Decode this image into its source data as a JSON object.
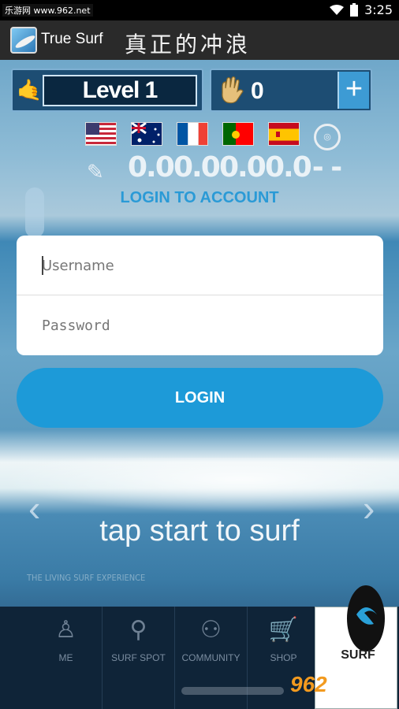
{
  "status_bar": {
    "watermark_text": "乐游网 www.962.net",
    "time": "3:25",
    "icons": [
      "wifi-icon",
      "battery-icon"
    ]
  },
  "app_bar": {
    "title": "True Surf",
    "subtitle": "真正的冲浪",
    "icon": "app-icon"
  },
  "hud": {
    "level_label": "Level 1",
    "coins": "0",
    "plus_label": "+",
    "icons": [
      "shaka-icon",
      "hand-icon",
      "plus-icon"
    ]
  },
  "flags": [
    {
      "country": "USA",
      "icon": "usa-flag-icon",
      "score": "0.0"
    },
    {
      "country": "Australia",
      "icon": "australia-flag-icon",
      "score": "0.0"
    },
    {
      "country": "France",
      "icon": "france-flag-icon",
      "score": "0.0"
    },
    {
      "country": "Portugal",
      "icon": "portugal-flag-icon",
      "score": "0.0"
    },
    {
      "country": "Spain",
      "icon": "spain-flag-icon",
      "score": "0.0"
    },
    {
      "country": "World",
      "icon": "world-seal-icon",
      "score": "- -"
    }
  ],
  "login": {
    "heading": "LOGIN TO ACCOUNT",
    "username_placeholder": "Username",
    "password_placeholder": "Password",
    "button_label": "LOGIN"
  },
  "main": {
    "tap_text": "tap start to surf",
    "fine_print": "THE LIVING SURF EXPERIENCE"
  },
  "bottom_nav": {
    "items": [
      {
        "label": "ME",
        "icon": "person-icon"
      },
      {
        "label": "SURF SPOT",
        "icon": "map-pin-icon"
      },
      {
        "label": "COMMUNITY",
        "icon": "community-icon"
      },
      {
        "label": "SHOP",
        "icon": "cart-icon"
      }
    ],
    "surf_label": "SURF"
  },
  "watermark": {
    "number": "962",
    "domain": ".NET",
    "cn": "乐游网"
  },
  "colors": {
    "accent": "#1d9ad8",
    "appbar": "#2a2a2a",
    "nav_bg": "#0f2438"
  }
}
